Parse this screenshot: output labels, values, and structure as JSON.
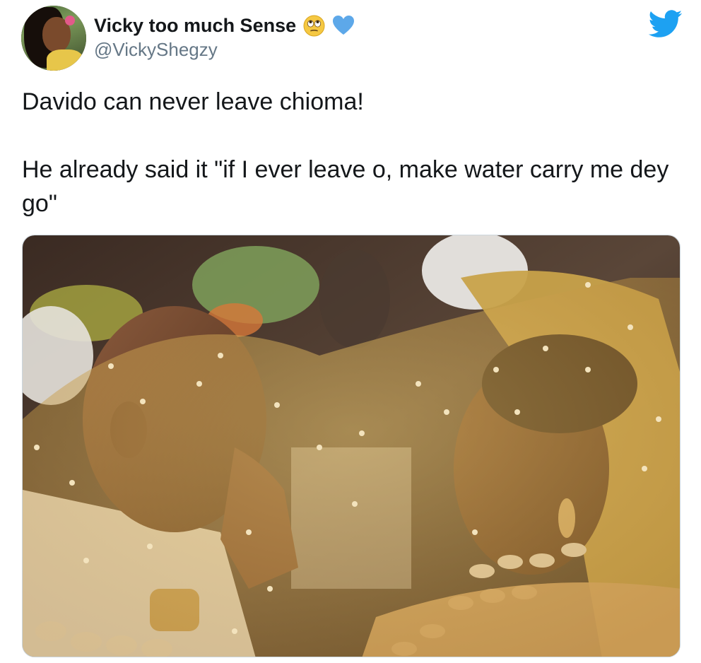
{
  "tweet": {
    "author": {
      "display_name": "Vicky too much Sense",
      "handle": "@VickyShegzy",
      "name_emoji": "face-with-rolling-eyes-icon",
      "name_heart": "blue-heart-icon",
      "avatar": "user-avatar"
    },
    "platform_icon": "twitter-bird-icon",
    "text": {
      "line1": "Davido can never leave chioma!",
      "line2": "He already said it \"if I ever leave o, make water carry me dey go\""
    },
    "media": {
      "type": "photo",
      "subject": "wedding-photo"
    }
  },
  "colors": {
    "twitter_blue": "#1da1f2",
    "heart_blue": "#5da8e9",
    "handle_gray": "#657786",
    "text_dark": "#14171a"
  }
}
